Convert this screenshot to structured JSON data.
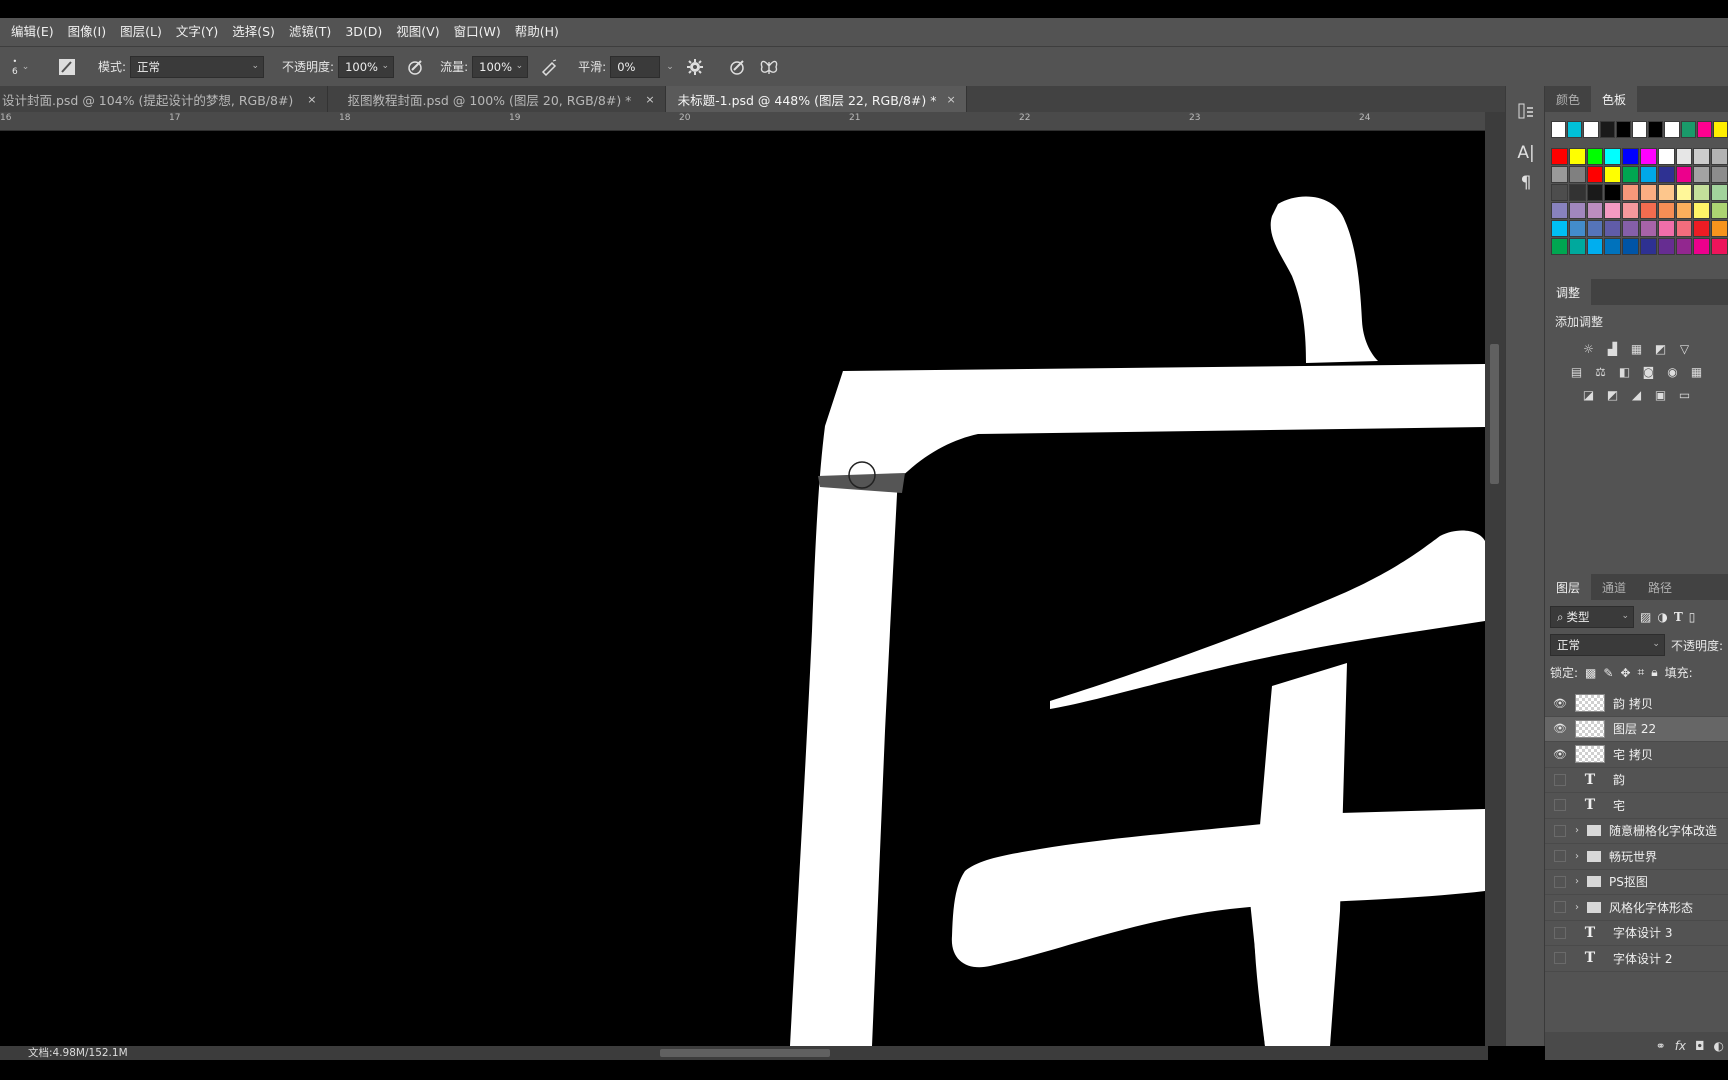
{
  "menu": [
    "编辑(E)",
    "图像(I)",
    "图层(L)",
    "文字(Y)",
    "选择(S)",
    "滤镜(T)",
    "3D(D)",
    "视图(V)",
    "窗口(W)",
    "帮助(H)"
  ],
  "options": {
    "brush_size": "6",
    "mode_label": "模式:",
    "mode_value": "正常",
    "opacity_label": "不透明度:",
    "opacity_value": "100%",
    "flow_label": "流量:",
    "flow_value": "100%",
    "smooth_label": "平滑:",
    "smooth_value": "0%"
  },
  "tabs": [
    {
      "label": "设计封面.psd @ 104% (提起设计的梦想, RGB/8#)",
      "close": "×"
    },
    {
      "label": "抠图教程封面.psd @ 100% (图层 20, RGB/8#) *",
      "close": "×"
    },
    {
      "label": "未标题-1.psd @ 448% (图层 22, RGB/8#) *",
      "close": "×"
    }
  ],
  "ruler_labels": [
    "16",
    "17",
    "18",
    "19",
    "20",
    "21",
    "22",
    "23",
    "24"
  ],
  "status": {
    "doc": "文档:4.98M/152.1M"
  },
  "color_panel": {
    "tabs": [
      "颜色",
      "色板"
    ],
    "active": "色板"
  },
  "swatches": [
    [
      "#ffffff",
      "#00c0d8",
      "#ffffff",
      "#1a1a1a",
      "#000000",
      "#ffffff",
      "#000000",
      "#ffffff",
      "#1a9a6a",
      "#ff0090",
      "#ffee00"
    ],
    [
      "#ff0000",
      "#ffff00",
      "#00ff00",
      "#00ffff",
      "#0000ff",
      "#ff00ff",
      "#ffffff",
      "#e6e6e6",
      "#cccccc",
      "#b3b3b3"
    ],
    [
      "#999999",
      "#808080",
      "#ff0000",
      "#ffff00",
      "#00a651",
      "#00a8e8",
      "#2e3192",
      "#ec008c",
      "#a3a3a3",
      "#8c8c8c"
    ],
    [
      "#4d4d4d",
      "#333333",
      "#1a1a1a",
      "#000000",
      "#f7977a",
      "#fbad82",
      "#fdc68c",
      "#fff799",
      "#c4df9b",
      "#a2d39c"
    ],
    [
      "#8882be",
      "#a187be",
      "#bc8dbf",
      "#f49ac2",
      "#f6989d",
      "#f26c4f",
      "#f68e55",
      "#fbaf5c",
      "#fff467",
      "#acd372"
    ],
    [
      "#00bff3",
      "#438ccb",
      "#5574b9",
      "#605ca8",
      "#855fa8",
      "#a763a8",
      "#f06ea9",
      "#f26d7d",
      "#ed1c24",
      "#f7941d"
    ],
    [
      "#00a651",
      "#00a99d",
      "#00aeef",
      "#0072bc",
      "#0054a6",
      "#2e3192",
      "#662d91",
      "#92278f",
      "#ec008c",
      "#ed145b"
    ]
  ],
  "adjust": {
    "tab": "调整",
    "title": "添加调整"
  },
  "layers_panel": {
    "tabs": [
      "图层",
      "通道",
      "路径"
    ],
    "filter": "类型",
    "blend": "正常",
    "opacity_label": "不透明度:",
    "lock_label": "锁定:",
    "fill_label": "填充:"
  },
  "layers": [
    {
      "name": "韵 拷贝",
      "kind": "raster",
      "visible": true
    },
    {
      "name": "图层 22",
      "kind": "raster",
      "visible": true,
      "selected": true
    },
    {
      "name": "宅 拷贝",
      "kind": "raster",
      "visible": true
    },
    {
      "name": "韵",
      "kind": "text",
      "visible": false
    },
    {
      "name": "宅",
      "kind": "text",
      "visible": false
    },
    {
      "name": "随意栅格化字体改造",
      "kind": "group",
      "visible": false
    },
    {
      "name": "畅玩世界",
      "kind": "group",
      "visible": false
    },
    {
      "name": "PS抠图",
      "kind": "group",
      "visible": false
    },
    {
      "name": "风格化字体形态",
      "kind": "group",
      "visible": false
    },
    {
      "name": "字体设计 3",
      "kind": "text",
      "visible": false
    },
    {
      "name": "字体设计 2",
      "kind": "text",
      "visible": false
    }
  ]
}
